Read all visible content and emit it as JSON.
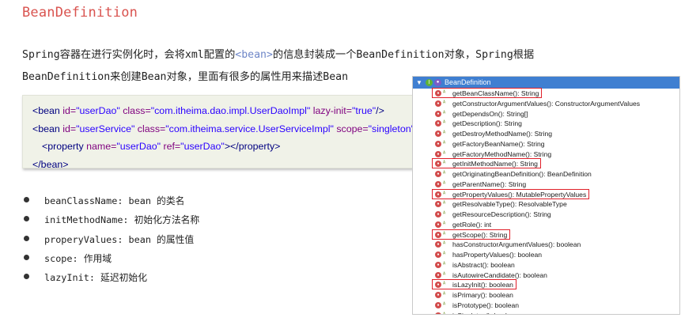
{
  "title": "BeanDefinition",
  "intro": {
    "line1_a": "Spring容器在进行实例化时，会将xml配置的",
    "line1_tag": "<bean>",
    "line1_b": "的信息封装成一个BeanDefinition对象，Spring根据",
    "line2": "BeanDefinition来创建Bean对象，里面有很多的属性用来描述Bean"
  },
  "code": {
    "l1": {
      "open": "<bean",
      "a1": " id=",
      "v1": "\"userDao\"",
      "a2": " class=",
      "v2": "\"com.itheima.dao.impl.UserDaoImpl\"",
      "a3": " lazy-init=",
      "v3": "\"true\"",
      "close": "/>"
    },
    "l2": {
      "open": "<bean",
      "a1": " id=",
      "v1": "\"userService\"",
      "a2": " class=",
      "v2": "\"com.itheima.service.UserServiceImpl\"",
      "a3": " scope=",
      "v3": "\"singleton\"",
      "close": ">"
    },
    "l3": {
      "open": "<property",
      "a1": " name=",
      "v1": "\"userDao\"",
      "a2": " ref=",
      "v2": "\"userDao\"",
      "close": "></property>"
    },
    "l4": {
      "close": "</bean>"
    }
  },
  "bullets": [
    "beanClassName: bean 的类名",
    "initMethodName: 初始化方法名称",
    "properyValues: bean 的属性值",
    "scope: 作用域",
    "lazyInit: 延迟初始化"
  ],
  "outline": {
    "title": "BeanDefinition",
    "methods": [
      "getBeanClassName(): String",
      "getConstructorArgumentValues(): ConstructorArgumentValues",
      "getDependsOn(): String[]",
      "getDescription(): String",
      "getDestroyMethodName(): String",
      "getFactoryBeanName(): String",
      "getFactoryMethodName(): String",
      "getInitMethodName(): String",
      "getOriginatingBeanDefinition(): BeanDefinition",
      "getParentName(): String",
      "getPropertyValues(): MutablePropertyValues",
      "getResolvableType(): ResolvableType",
      "getResourceDescription(): String",
      "getRole(): int",
      "getScope(): String",
      "hasConstructorArgumentValues(): boolean",
      "hasPropertyValues(): boolean",
      "isAbstract(): boolean",
      "isAutowireCandidate(): boolean",
      "isLazyInit(): boolean",
      "isPrimary(): boolean",
      "isPrototype(): boolean",
      "isSingleton(): boolean"
    ],
    "highlighted": [
      0,
      7,
      10,
      14,
      19
    ],
    "method_icon": "public-method-icon",
    "abstract_marker": "abstract-marker-icon",
    "highlight_color": "#e0202a",
    "header_color": "#3f7fd1"
  }
}
